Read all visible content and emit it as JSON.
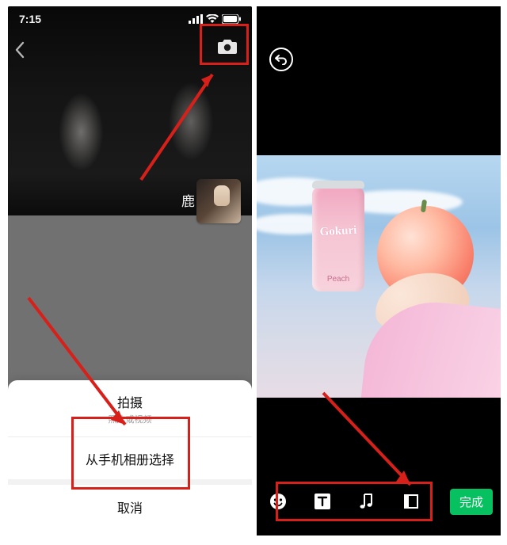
{
  "left": {
    "status": {
      "time": "7:15"
    },
    "profile_name": "鹿",
    "sheet": {
      "capture_label": "拍摄",
      "capture_subtitle": "照片或视频",
      "gallery_label": "从手机相册选择",
      "cancel_label": "取消"
    }
  },
  "right": {
    "can": {
      "brand": "Gokuri",
      "flavor": "Peach"
    },
    "done_label": "完成"
  }
}
